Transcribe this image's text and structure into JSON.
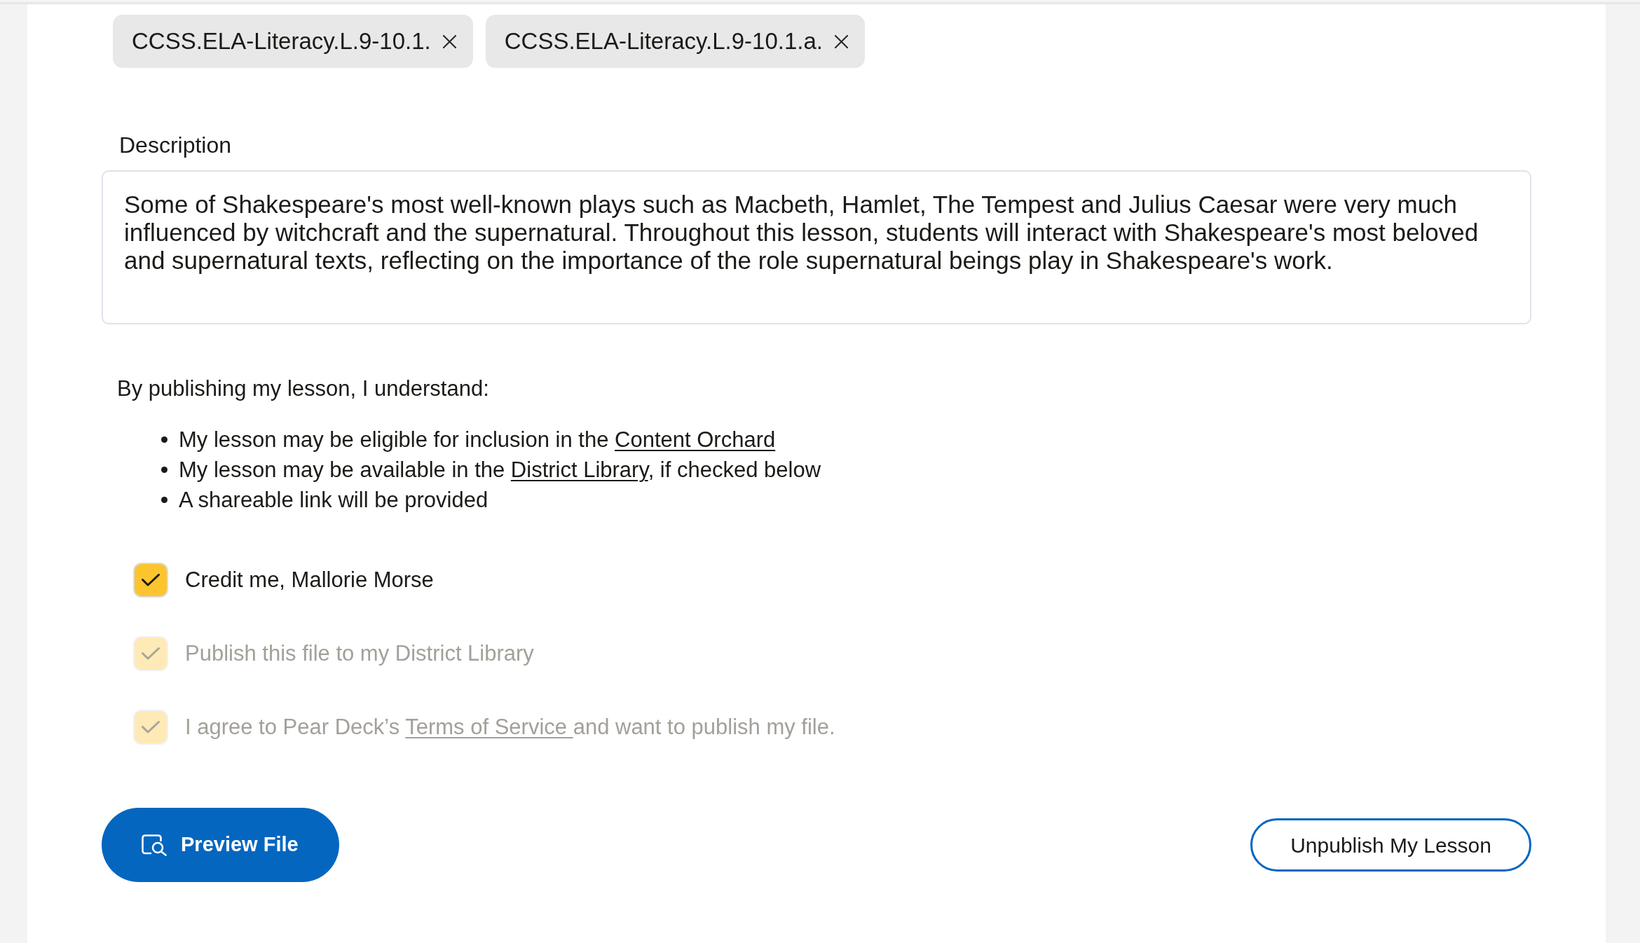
{
  "standards": [
    {
      "label": "CCSS.ELA-Literacy.L.9-10.1."
    },
    {
      "label": "CCSS.ELA-Literacy.L.9-10.1.a."
    }
  ],
  "description": {
    "label": "Description",
    "value": "Some of Shakespeare's most well-known plays such as Macbeth, Hamlet, The Tempest and Julius Caesar were very much influenced by witchcraft and the supernatural. Throughout this lesson, students will interact with Shakespeare's most beloved and supernatural texts, reflecting on the importance of the role supernatural beings play in Shakespeare's work."
  },
  "terms": {
    "intro": "By publishing my lesson, I understand:",
    "items": [
      {
        "parts": [
          {
            "kind": "text",
            "text": "My lesson may be eligible for inclusion in the "
          },
          {
            "kind": "link",
            "text": "Content Orchard"
          }
        ]
      },
      {
        "parts": [
          {
            "kind": "text",
            "text": "My lesson may be available in the "
          },
          {
            "kind": "link",
            "text": "District Library"
          },
          {
            "kind": "text",
            "text": ", if checked below"
          }
        ]
      },
      {
        "parts": [
          {
            "kind": "text",
            "text": "A shareable link will be provided"
          }
        ]
      }
    ]
  },
  "options": [
    {
      "parts": [
        {
          "kind": "text",
          "text": "Credit me, Mallorie Morse"
        }
      ],
      "checked": true,
      "disabled": false
    },
    {
      "parts": [
        {
          "kind": "text",
          "text": "Publish this file to my District Library"
        }
      ],
      "checked": true,
      "disabled": true
    },
    {
      "parts": [
        {
          "kind": "text",
          "text": "I agree to Pear Deck’s "
        },
        {
          "kind": "link",
          "text": "Terms of Service "
        },
        {
          "kind": "text",
          "text": "and want to publish my file."
        }
      ],
      "checked": true,
      "disabled": true
    }
  ],
  "actions": [
    {
      "kind": "primary",
      "label": "Preview File"
    },
    {
      "kind": "secondary",
      "label": "Unpublish My Lesson"
    }
  ]
}
